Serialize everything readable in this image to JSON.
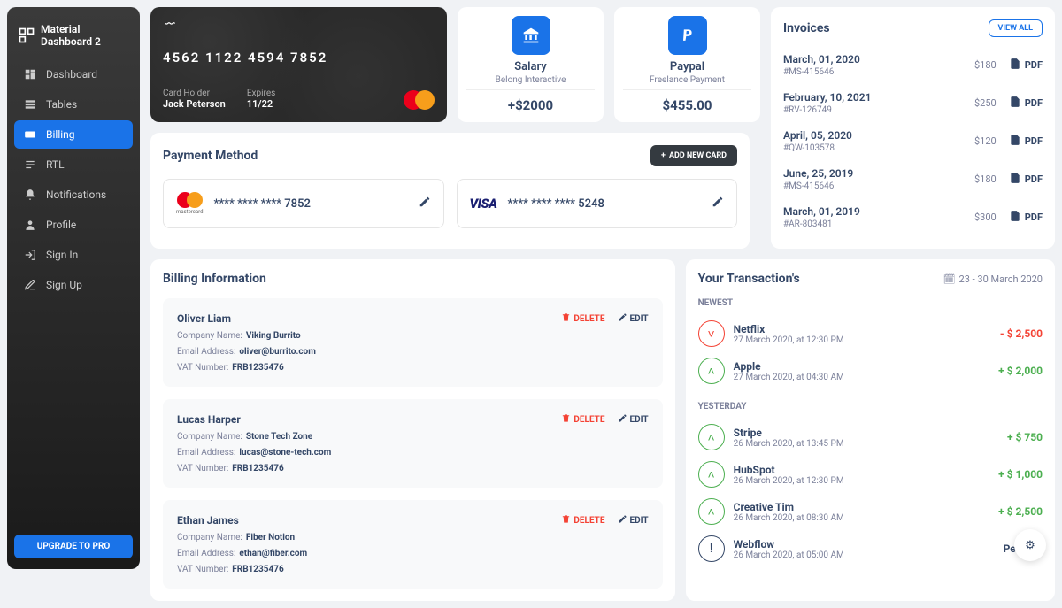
{
  "brand": "Material Dashboard 2",
  "nav": [
    {
      "label": "Dashboard",
      "icon": "▦"
    },
    {
      "label": "Tables",
      "icon": "▤"
    },
    {
      "label": "Billing",
      "icon": "▭",
      "active": true
    },
    {
      "label": "RTL",
      "icon": "⬚"
    },
    {
      "label": "Notifications",
      "icon": "🔔"
    },
    {
      "label": "Profile",
      "icon": "👤"
    },
    {
      "label": "Sign In",
      "icon": "→]"
    },
    {
      "label": "Sign Up",
      "icon": "✎"
    }
  ],
  "upgrade": "UPGRADE TO PRO",
  "credit_card": {
    "number": "4562  1122  4594  7852",
    "holder_label": "Card Holder",
    "holder": "Jack Peterson",
    "expires_label": "Expires",
    "expires": "11/22"
  },
  "stats": [
    {
      "title": "Salary",
      "sub": "Belong Interactive",
      "val": "+$2000",
      "icon": "bank"
    },
    {
      "title": "Paypal",
      "sub": "Freelance Payment",
      "val": "$455.00",
      "icon": "paypal"
    }
  ],
  "invoices": {
    "title": "Invoices",
    "view_all": "VIEW ALL",
    "pdf": "PDF",
    "items": [
      {
        "date": "March, 01, 2020",
        "id": "#MS-415646",
        "amt": "$180"
      },
      {
        "date": "February, 10, 2021",
        "id": "#RV-126749",
        "amt": "$250"
      },
      {
        "date": "April, 05, 2020",
        "id": "#QW-103578",
        "amt": "$120"
      },
      {
        "date": "June, 25, 2019",
        "id": "#MS-415646",
        "amt": "$180"
      },
      {
        "date": "March, 01, 2019",
        "id": "#AR-803481",
        "amt": "$300"
      }
    ]
  },
  "payment": {
    "title": "Payment Method",
    "add": "ADD NEW CARD",
    "cards": [
      {
        "brand": "mastercard",
        "num": "****  ****  ****  7852"
      },
      {
        "brand": "visa",
        "num": "****  ****  ****  5248"
      }
    ]
  },
  "billing": {
    "title": "Billing Information",
    "delete": "DELETE",
    "edit": "EDIT",
    "company_label": "Company Name:",
    "email_label": "Email Address:",
    "vat_label": "VAT Number:",
    "items": [
      {
        "name": "Oliver Liam",
        "company": "Viking Burrito",
        "email": "oliver@burrito.com",
        "vat": "FRB1235476"
      },
      {
        "name": "Lucas Harper",
        "company": "Stone Tech Zone",
        "email": "lucas@stone-tech.com",
        "vat": "FRB1235476"
      },
      {
        "name": "Ethan James",
        "company": "Fiber Notion",
        "email": "ethan@fiber.com",
        "vat": "FRB1235476"
      }
    ]
  },
  "tx": {
    "title": "Your Transaction's",
    "range": "23 - 30 March 2020",
    "g1": "NEWEST",
    "g2": "YESTERDAY",
    "newest": [
      {
        "name": "Netflix",
        "time": "27 March 2020, at 12:30 PM",
        "amt": "- $ 2,500",
        "dir": "down"
      },
      {
        "name": "Apple",
        "time": "27 March 2020, at 04:30 AM",
        "amt": "+ $ 2,000",
        "dir": "up"
      }
    ],
    "yesterday": [
      {
        "name": "Stripe",
        "time": "26 March 2020, at 13:45 PM",
        "amt": "+ $ 750",
        "dir": "up"
      },
      {
        "name": "HubSpot",
        "time": "26 March 2020, at 12:30 PM",
        "amt": "+ $ 1,000",
        "dir": "up"
      },
      {
        "name": "Creative Tim",
        "time": "26 March 2020, at 08:30 AM",
        "amt": "+ $ 2,500",
        "dir": "up"
      },
      {
        "name": "Webflow",
        "time": "26 March 2020, at 05:00 AM",
        "amt": "Pending",
        "dir": "pend"
      }
    ]
  }
}
